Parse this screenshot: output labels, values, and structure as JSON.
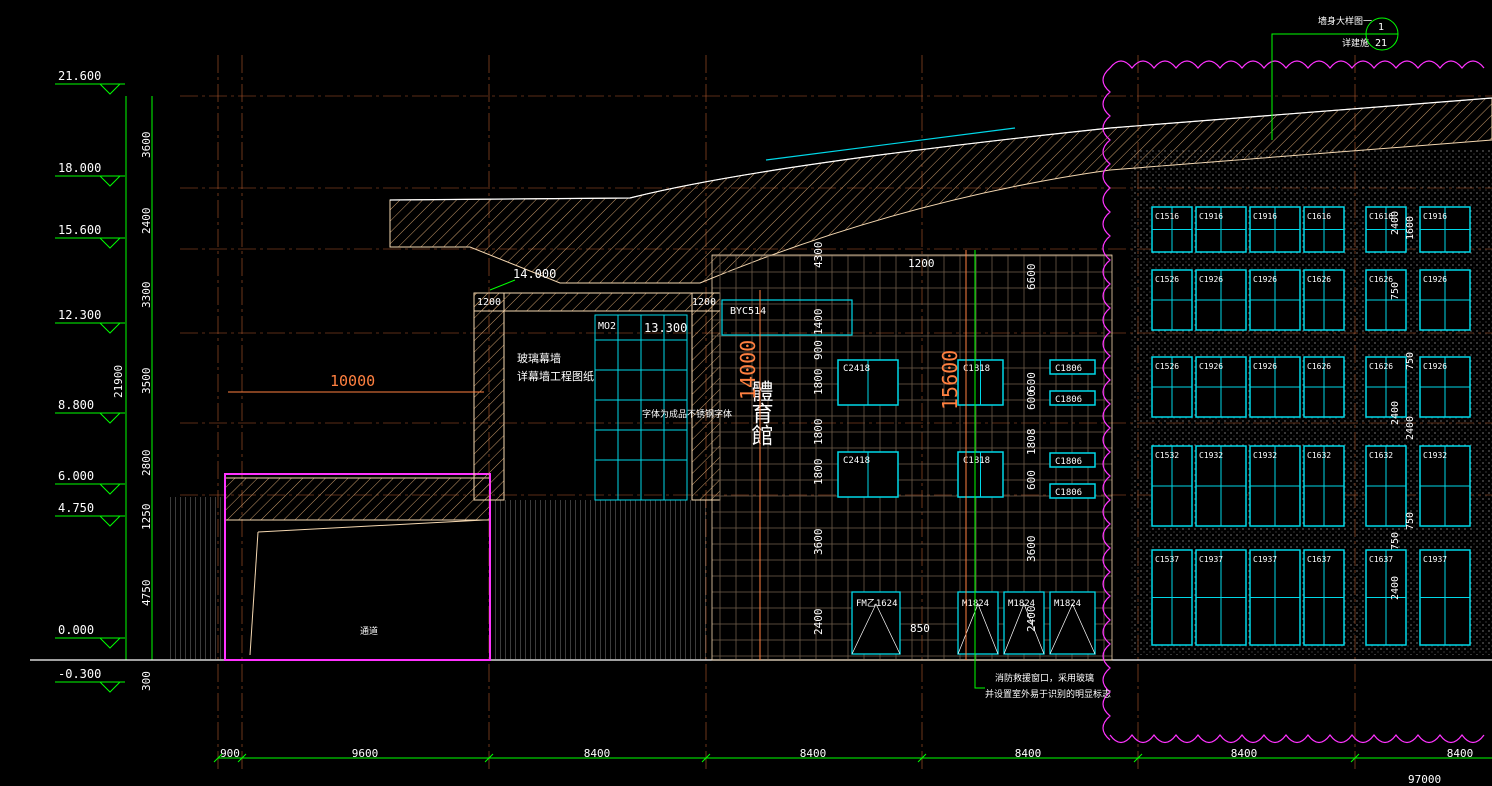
{
  "colors": {
    "background": "#000000",
    "dimension": "#00ff00",
    "structure": "#f4d7b0",
    "window": "#00d8e8",
    "axis": "#ff8040",
    "revision_cloud": "#ff33ff",
    "text": "#ffffff"
  },
  "elevation_marks": [
    "21.600",
    "18.000",
    "15.600",
    "12.300",
    "8.800",
    "6.000",
    "4.750",
    "0.000",
    "-0.300"
  ],
  "vertical_dims": [
    "3600",
    "2400",
    "3300",
    "3500",
    "2800",
    "1250",
    "4750",
    "300"
  ],
  "total_height_dim": "21900",
  "bottom_dims": [
    "900",
    "9600",
    "8400",
    "8400",
    "8400",
    "8400",
    "8400"
  ],
  "overall_width_dim": "97000",
  "tags": {
    "detail_ref_label_1": "墙身大样图一",
    "detail_ref_label_2": "详建施",
    "detail_ref_no": "1",
    "detail_ref_sheet": "21",
    "roof_level": "14.000",
    "mid_level": "13.300",
    "beam_1200_a": "1200",
    "beam_1200_b": "1200",
    "beam_1200_c": "1200",
    "span_10000": "10000",
    "glass_curtain_1": "玻璃幕墙",
    "glass_curtain_2": "详幕墙工程图纸",
    "door_mo2": "MO2",
    "window_byc": "BYC514",
    "signage_text": "字体为成品不锈钢字体",
    "signage_chars": "體育館",
    "height_14000": "14000",
    "height_15600": "15600",
    "dim_850": "850",
    "fire_note_1": "消防救援窗口，采用玻璃",
    "fire_note_2": "并设置室外易于识别的明显标志",
    "entrance": "通道"
  },
  "middle_dims": [
    "4300",
    "1400",
    "900",
    "1800",
    "1800",
    "1800",
    "3600",
    "2400"
  ],
  "right_dims": [
    "6600",
    "600",
    "600",
    "1808",
    "600",
    "3600",
    "2400"
  ],
  "windows_mid": [
    "C2418",
    "C2418",
    "C1818",
    "C1818",
    "C1806",
    "C1806",
    "C1806",
    "C1806"
  ],
  "doors": [
    "FM乙1624",
    "M1824",
    "M1824",
    "M1824"
  ],
  "grid_windows": [
    [
      "C1516",
      "C1916",
      "C1916",
      "C1616",
      "C1616",
      "C1916"
    ],
    [
      "C1526",
      "C1926",
      "C1926",
      "C1626",
      "C1626",
      "C1926"
    ],
    [
      "C1526",
      "C1926",
      "C1926",
      "C1626",
      "C1626",
      "C1926"
    ],
    [
      "C1532",
      "C1932",
      "C1932",
      "C1632",
      "C1632",
      "C1932"
    ],
    [
      "C1537",
      "C1937",
      "C1937",
      "C1637",
      "C1637",
      "C1937"
    ]
  ],
  "grid_dims_a": [
    "1600",
    "750",
    "2400",
    "750"
  ],
  "grid_dims_b": [
    "2400",
    "750",
    "2400",
    "750",
    "2400"
  ]
}
